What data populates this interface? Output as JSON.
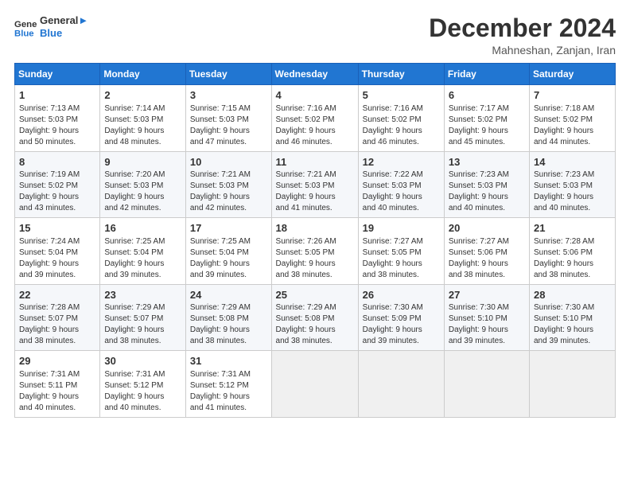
{
  "logo": {
    "line1": "General",
    "line2": "Blue"
  },
  "title": "December 2024",
  "subtitle": "Mahneshan, Zanjan, Iran",
  "header": {
    "days": [
      "Sunday",
      "Monday",
      "Tuesday",
      "Wednesday",
      "Thursday",
      "Friday",
      "Saturday"
    ]
  },
  "weeks": [
    [
      {
        "day": "1",
        "info": "Sunrise: 7:13 AM\nSunset: 5:03 PM\nDaylight: 9 hours\nand 50 minutes."
      },
      {
        "day": "2",
        "info": "Sunrise: 7:14 AM\nSunset: 5:03 PM\nDaylight: 9 hours\nand 48 minutes."
      },
      {
        "day": "3",
        "info": "Sunrise: 7:15 AM\nSunset: 5:03 PM\nDaylight: 9 hours\nand 47 minutes."
      },
      {
        "day": "4",
        "info": "Sunrise: 7:16 AM\nSunset: 5:02 PM\nDaylight: 9 hours\nand 46 minutes."
      },
      {
        "day": "5",
        "info": "Sunrise: 7:16 AM\nSunset: 5:02 PM\nDaylight: 9 hours\nand 46 minutes."
      },
      {
        "day": "6",
        "info": "Sunrise: 7:17 AM\nSunset: 5:02 PM\nDaylight: 9 hours\nand 45 minutes."
      },
      {
        "day": "7",
        "info": "Sunrise: 7:18 AM\nSunset: 5:02 PM\nDaylight: 9 hours\nand 44 minutes."
      }
    ],
    [
      {
        "day": "8",
        "info": "Sunrise: 7:19 AM\nSunset: 5:02 PM\nDaylight: 9 hours\nand 43 minutes."
      },
      {
        "day": "9",
        "info": "Sunrise: 7:20 AM\nSunset: 5:03 PM\nDaylight: 9 hours\nand 42 minutes."
      },
      {
        "day": "10",
        "info": "Sunrise: 7:21 AM\nSunset: 5:03 PM\nDaylight: 9 hours\nand 42 minutes."
      },
      {
        "day": "11",
        "info": "Sunrise: 7:21 AM\nSunset: 5:03 PM\nDaylight: 9 hours\nand 41 minutes."
      },
      {
        "day": "12",
        "info": "Sunrise: 7:22 AM\nSunset: 5:03 PM\nDaylight: 9 hours\nand 40 minutes."
      },
      {
        "day": "13",
        "info": "Sunrise: 7:23 AM\nSunset: 5:03 PM\nDaylight: 9 hours\nand 40 minutes."
      },
      {
        "day": "14",
        "info": "Sunrise: 7:23 AM\nSunset: 5:03 PM\nDaylight: 9 hours\nand 40 minutes."
      }
    ],
    [
      {
        "day": "15",
        "info": "Sunrise: 7:24 AM\nSunset: 5:04 PM\nDaylight: 9 hours\nand 39 minutes."
      },
      {
        "day": "16",
        "info": "Sunrise: 7:25 AM\nSunset: 5:04 PM\nDaylight: 9 hours\nand 39 minutes."
      },
      {
        "day": "17",
        "info": "Sunrise: 7:25 AM\nSunset: 5:04 PM\nDaylight: 9 hours\nand 39 minutes."
      },
      {
        "day": "18",
        "info": "Sunrise: 7:26 AM\nSunset: 5:05 PM\nDaylight: 9 hours\nand 38 minutes."
      },
      {
        "day": "19",
        "info": "Sunrise: 7:27 AM\nSunset: 5:05 PM\nDaylight: 9 hours\nand 38 minutes."
      },
      {
        "day": "20",
        "info": "Sunrise: 7:27 AM\nSunset: 5:06 PM\nDaylight: 9 hours\nand 38 minutes."
      },
      {
        "day": "21",
        "info": "Sunrise: 7:28 AM\nSunset: 5:06 PM\nDaylight: 9 hours\nand 38 minutes."
      }
    ],
    [
      {
        "day": "22",
        "info": "Sunrise: 7:28 AM\nSunset: 5:07 PM\nDaylight: 9 hours\nand 38 minutes."
      },
      {
        "day": "23",
        "info": "Sunrise: 7:29 AM\nSunset: 5:07 PM\nDaylight: 9 hours\nand 38 minutes."
      },
      {
        "day": "24",
        "info": "Sunrise: 7:29 AM\nSunset: 5:08 PM\nDaylight: 9 hours\nand 38 minutes."
      },
      {
        "day": "25",
        "info": "Sunrise: 7:29 AM\nSunset: 5:08 PM\nDaylight: 9 hours\nand 38 minutes."
      },
      {
        "day": "26",
        "info": "Sunrise: 7:30 AM\nSunset: 5:09 PM\nDaylight: 9 hours\nand 39 minutes."
      },
      {
        "day": "27",
        "info": "Sunrise: 7:30 AM\nSunset: 5:10 PM\nDaylight: 9 hours\nand 39 minutes."
      },
      {
        "day": "28",
        "info": "Sunrise: 7:30 AM\nSunset: 5:10 PM\nDaylight: 9 hours\nand 39 minutes."
      }
    ],
    [
      {
        "day": "29",
        "info": "Sunrise: 7:31 AM\nSunset: 5:11 PM\nDaylight: 9 hours\nand 40 minutes."
      },
      {
        "day": "30",
        "info": "Sunrise: 7:31 AM\nSunset: 5:12 PM\nDaylight: 9 hours\nand 40 minutes."
      },
      {
        "day": "31",
        "info": "Sunrise: 7:31 AM\nSunset: 5:12 PM\nDaylight: 9 hours\nand 41 minutes."
      },
      {
        "day": "",
        "info": ""
      },
      {
        "day": "",
        "info": ""
      },
      {
        "day": "",
        "info": ""
      },
      {
        "day": "",
        "info": ""
      }
    ]
  ]
}
